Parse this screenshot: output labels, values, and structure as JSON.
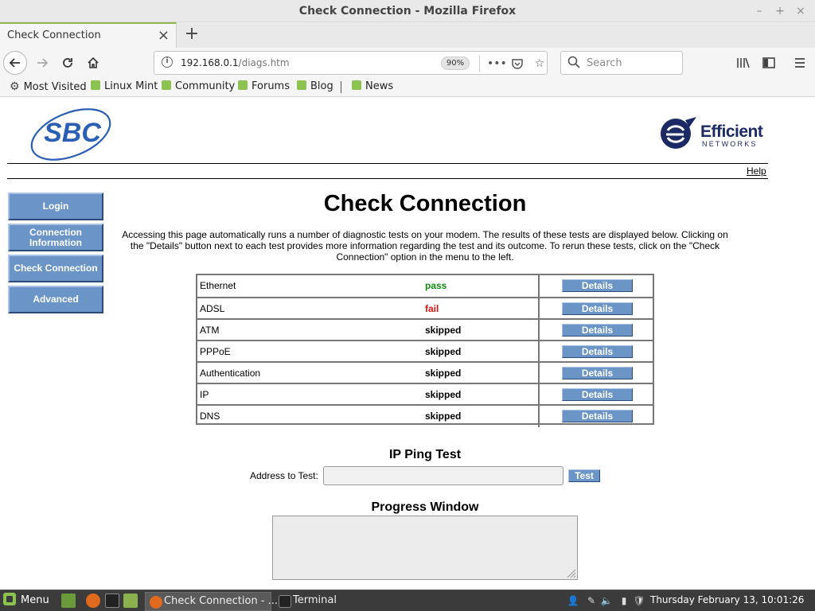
{
  "window": {
    "title": "Check Connection - Mozilla Firefox",
    "controls": [
      "–",
      "+",
      "×"
    ]
  },
  "tab": {
    "label": "Check Connection",
    "close": "×"
  },
  "newtab": "+",
  "navbar": {
    "url_host": "192.168.0.1",
    "url_path": "/diags.htm",
    "zoom": "90%",
    "search_placeholder": "Search"
  },
  "bookmarks": [
    {
      "label": "Most Visited",
      "icon": "gear-icon"
    },
    {
      "label": "Linux Mint",
      "icon": "mint-bookmark-icon"
    },
    {
      "label": "Community",
      "icon": "mint-bookmark-icon"
    },
    {
      "label": "Forums",
      "icon": "mint-bookmark-icon"
    },
    {
      "label": "Blog",
      "icon": "mint-bookmark-icon"
    },
    {
      "label": "News",
      "icon": "mint-bookmark-icon"
    }
  ],
  "page": {
    "sbc_logo": "SBC",
    "efficient_logo_word": "Efficient",
    "efficient_logo_sub": "NETWORKS",
    "help": "Help",
    "menu": {
      "login": "Login",
      "connection_information": "Connection Information",
      "check_connection": "Check Connection",
      "advanced": "Advanced"
    },
    "title": "Check Connection",
    "description": "Accessing this page automatically runs a number of diagnostic tests on your modem. The results of these tests are displayed below. Clicking on the \"Details\" button next to each test provides more information regarding the test and its outcome. To rerun these tests, click on the \"Check Connection\" option in the menu to the left.",
    "tests": [
      {
        "name": "Ethernet",
        "status": "pass",
        "details": "Details"
      },
      {
        "name": "ADSL",
        "status": "fail",
        "details": "Details"
      },
      {
        "name": "ATM",
        "status": "skipped",
        "details": "Details"
      },
      {
        "name": "PPPoE",
        "status": "skipped",
        "details": "Details"
      },
      {
        "name": "Authentication",
        "status": "skipped",
        "details": "Details"
      },
      {
        "name": "IP",
        "status": "skipped",
        "details": "Details"
      },
      {
        "name": "DNS",
        "status": "skipped",
        "details": "Details"
      }
    ],
    "status_colors": {
      "pass": "#118a11",
      "fail": "#dd1111",
      "skipped": "#000000"
    },
    "ping_title": "IP Ping Test",
    "ping_label": "Address to Test:",
    "ping_value": "",
    "test_button": "Test",
    "progress_title": "Progress Window"
  },
  "taskbar": {
    "menu": "Menu",
    "tasks": [
      {
        "label": "Check Connection - ...",
        "icon": "firefox-icon"
      },
      {
        "label": "Terminal",
        "icon": "terminal-icon"
      }
    ],
    "clock": "Thursday February 13, 10:01:26"
  },
  "colors": {
    "button_blue": "#6b94c7",
    "sbc_blue": "#2b5fb4",
    "efficient_navy": "#1c2a63",
    "mint_green": "#8cc24f"
  }
}
